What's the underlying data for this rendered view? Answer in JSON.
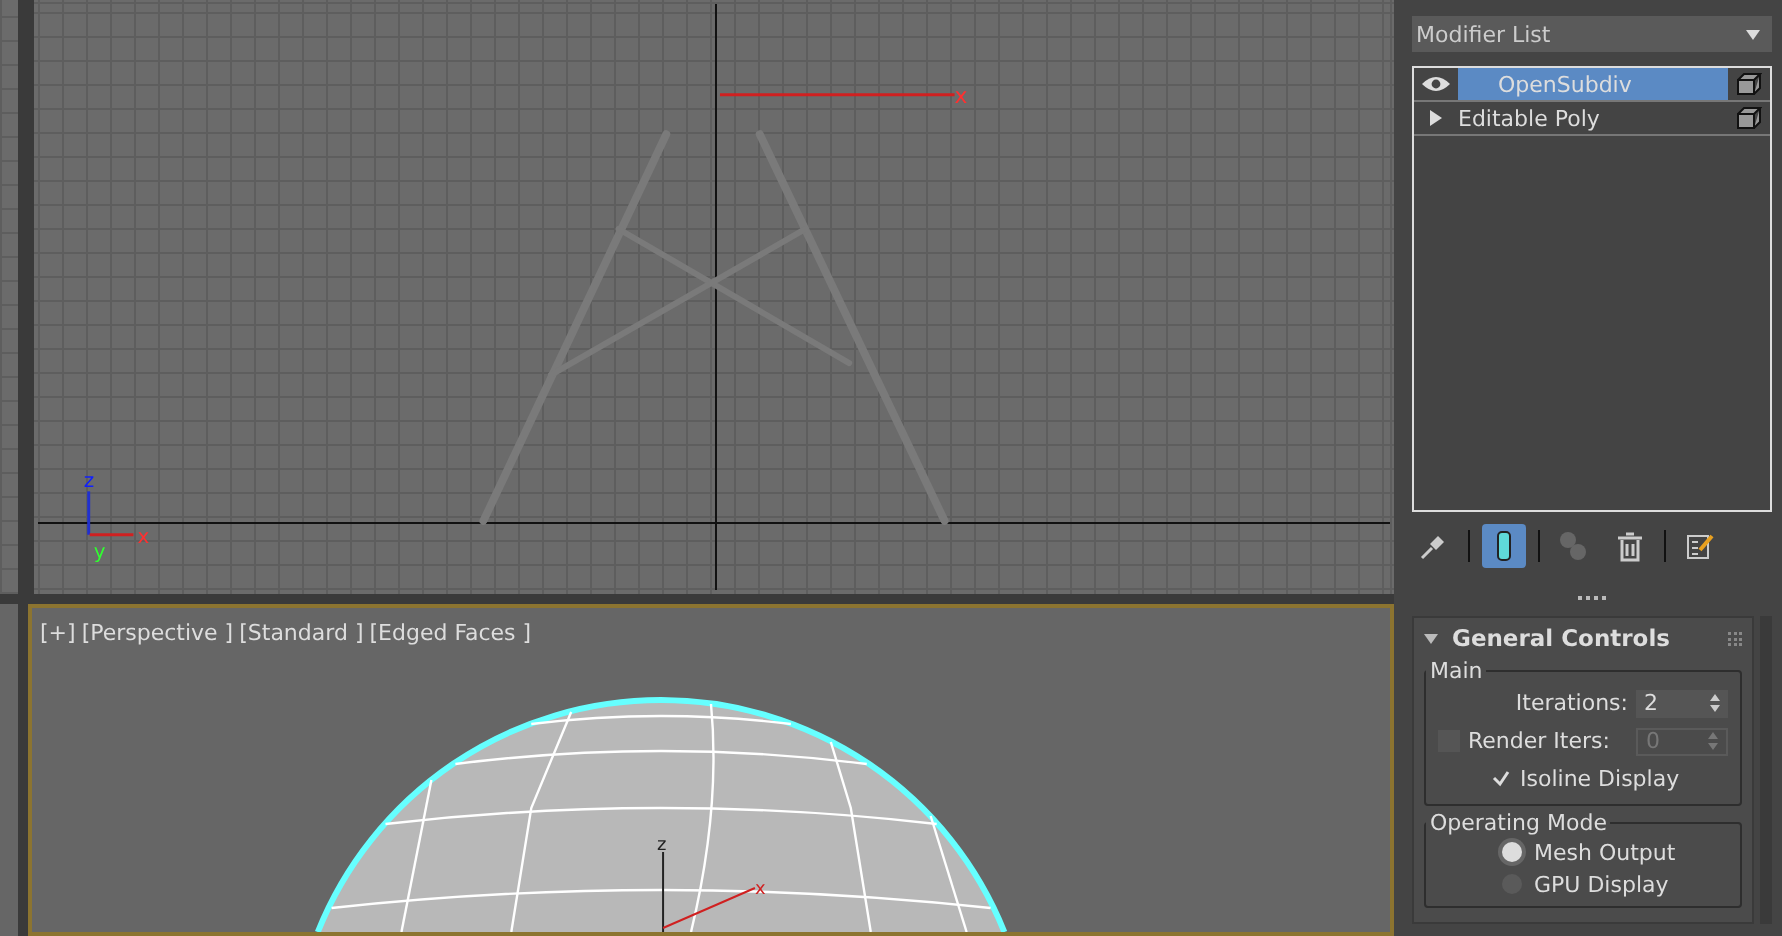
{
  "viewports": [
    {
      "kind": "ortho",
      "selected": false,
      "axis_labels": [
        "z",
        "y",
        "x"
      ],
      "gizmo_label": "x"
    },
    {
      "kind": "perspective",
      "selected": true,
      "labels": [
        "[+]",
        "[Perspective ]",
        "[Standard ]",
        "[Edged Faces ]"
      ],
      "gizmo_labels": [
        "z",
        "x"
      ]
    }
  ],
  "modifier_list": {
    "label": "Modifier List"
  },
  "stack": [
    {
      "label": "OpenSubdiv",
      "selected": true,
      "expandable": false
    },
    {
      "label": "Editable Poly",
      "selected": false,
      "expandable": true
    }
  ],
  "stack_toolbar": [
    {
      "kind": "pin",
      "selected": false
    },
    {
      "kind": "end-result",
      "selected": true
    },
    {
      "kind": "unique",
      "selected": false
    },
    {
      "kind": "remove",
      "selected": false
    },
    {
      "kind": "configure",
      "selected": false
    }
  ],
  "rollout": {
    "title": "General Controls",
    "expanded": true,
    "main": {
      "title": "Main",
      "iterations_label": "Iterations:",
      "iterations": "2",
      "render_iters": {
        "label": "Render Iters:",
        "checked": false,
        "value": "0",
        "disabled": true
      },
      "isoline": {
        "label": "Isoline Display",
        "checked": true
      }
    },
    "operating_mode": {
      "title": "Operating Mode",
      "options": [
        {
          "label": "Mesh Output",
          "selected": true
        },
        {
          "label": "GPU Display",
          "selected": false
        }
      ]
    }
  }
}
